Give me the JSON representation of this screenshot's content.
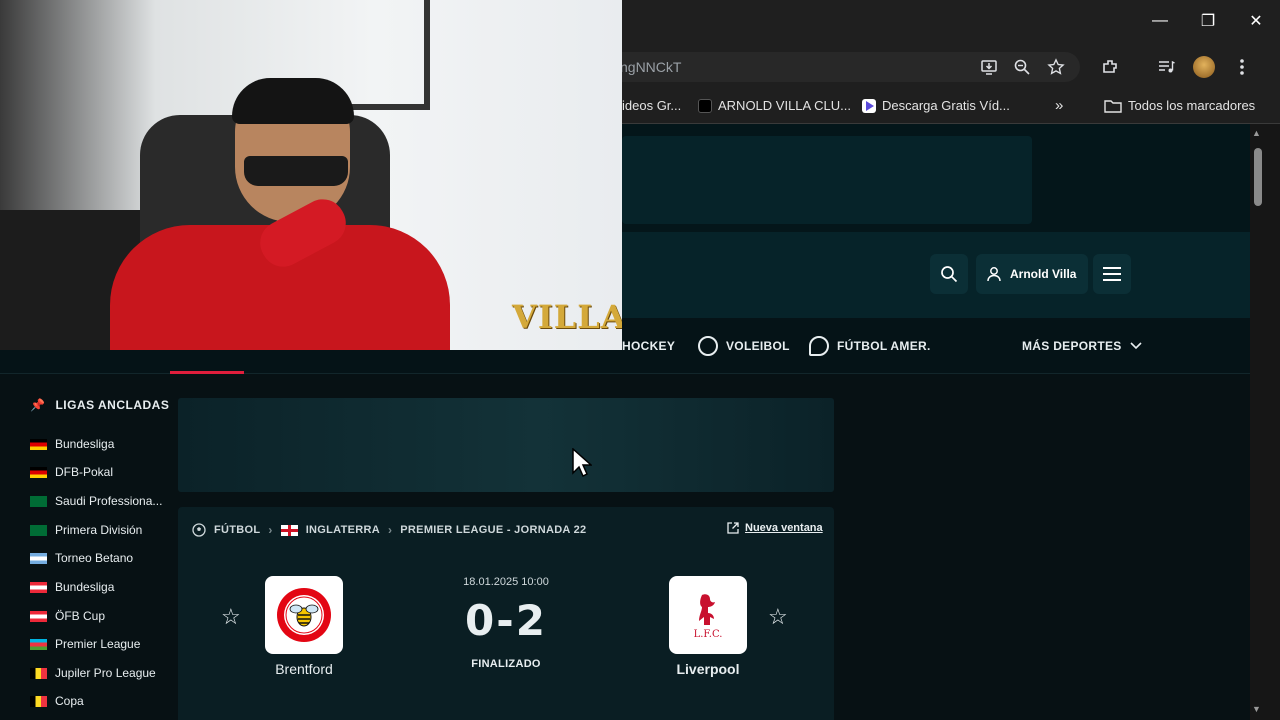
{
  "browser": {
    "url_fragment": "ngNNCkT",
    "window_controls": {
      "minimize": "—",
      "restore": "❐",
      "close": "✕"
    },
    "bookmarks": [
      {
        "label": "ideos Gr...",
        "color": "#1a73e8"
      },
      {
        "label": "ARNOLD VILLA CLU...",
        "color": "#000000"
      },
      {
        "label": "Descarga Gratis Víd...",
        "color": "#5b4bdb"
      }
    ],
    "bookmarks_overflow": "»",
    "all_bookmarks_label": "Todos los marcadores"
  },
  "header": {
    "account_name": "Arnold Villa"
  },
  "sports_nav": {
    "items": [
      {
        "label": "HOCKEY",
        "icon": "hockey-icon"
      },
      {
        "label": "VOLEIBOL",
        "icon": "volleyball-icon"
      },
      {
        "label": "FÚTBOL AMER.",
        "icon": "american-football-icon"
      }
    ],
    "more_label": "MÁS DEPORTES",
    "active_color": "#e01e3c"
  },
  "sidebar": {
    "title": "LIGAS ANCLADAS",
    "leagues": [
      {
        "label": "Bundesliga",
        "flag": "germany"
      },
      {
        "label": "DFB-Pokal",
        "flag": "germany"
      },
      {
        "label": "Saudi Professiona...",
        "flag": "saudi-arabia"
      },
      {
        "label": "Primera División",
        "flag": "saudi-arabia"
      },
      {
        "label": "Torneo Betano",
        "flag": "argentina"
      },
      {
        "label": "Bundesliga",
        "flag": "austria"
      },
      {
        "label": "ÖFB Cup",
        "flag": "austria"
      },
      {
        "label": "Premier League",
        "flag": "azerbaijan"
      },
      {
        "label": "Jupiler Pro League",
        "flag": "belgium"
      },
      {
        "label": "Copa",
        "flag": "belgium"
      }
    ]
  },
  "match": {
    "breadcrumb": [
      "FÚTBOL",
      "INGLATERRA",
      "PREMIER LEAGUE - JORNADA 22"
    ],
    "new_window_label": "Nueva ventana",
    "date": "18.01.2025 10:00",
    "score": "0-2",
    "status": "FINALIZADO",
    "home_team": "Brentford",
    "away_team": "Liverpool"
  },
  "webcam": {
    "overlay_logo": "VILLA"
  }
}
